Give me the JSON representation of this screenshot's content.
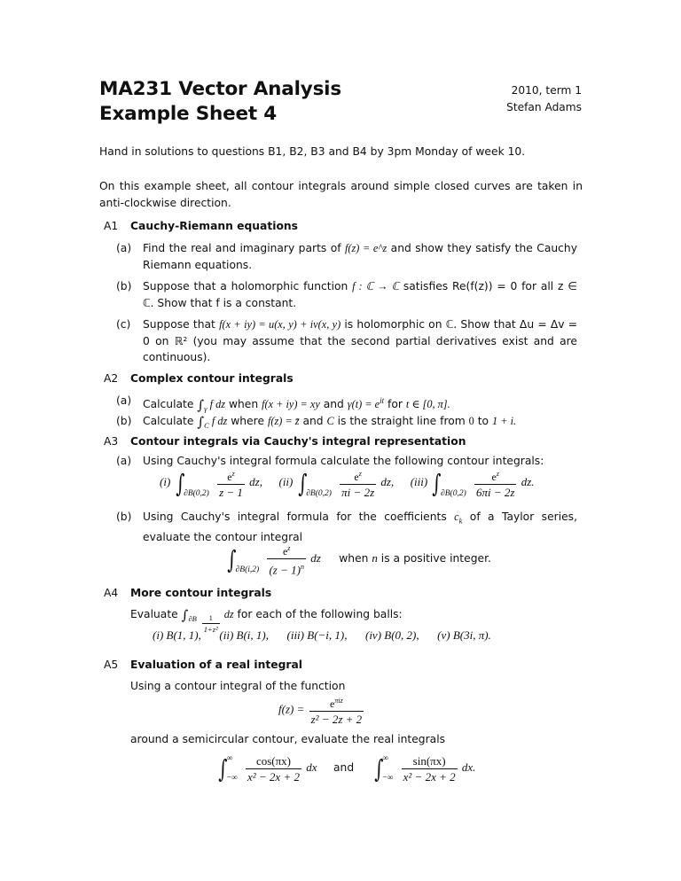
{
  "header": {
    "title_line1": "MA231 Vector Analysis",
    "title_line2": "Example Sheet 4",
    "term": "2010, term 1",
    "author": "Stefan Adams"
  },
  "intro": {
    "hand_in": "Hand in solutions to questions B1, B2, B3 and B4 by 3pm Monday of week 10.",
    "convention": "On this example sheet, all contour integrals around simple closed curves are taken in anti-clockwise direction."
  },
  "questions": {
    "a1": {
      "num": "A1",
      "title": "Cauchy-Riemann equations",
      "items": [
        {
          "label": "(a)",
          "text_before": "Find the real and imaginary parts of ",
          "math": "f(z) = e^z",
          "text_after": " and show they satisfy the Cauchy Riemann equations."
        },
        {
          "label": "(b)",
          "text_before": "Suppose that a holomorphic function ",
          "math": "f : ℂ → ℂ",
          "text_after": " satisfies Re(f(z)) = 0 for all z ∈ ℂ. Show that f is a constant."
        },
        {
          "label": "(c)",
          "text_before": "Suppose that ",
          "math": "f(x + iy) = u(x, y) + iv(x, y)",
          "text_after": " is holomorphic on ℂ. Show that Δu = Δv = 0 on ℝ² (you may assume that the second partial derivatives exist and are continuous)."
        }
      ]
    },
    "a2": {
      "num": "A2",
      "title": "Complex contour integrals",
      "items": [
        {
          "label": "(a)",
          "calc": "Calculate ",
          "integral": "∫",
          "sub": "γ",
          "fdz": " f dz",
          "when": " when ",
          "expr": "f(x + iy) = xy",
          "and": " and ",
          "expr2": "γ(t) = e",
          "exp": "it",
          "for": " for ",
          "range": "t ∈ [0, π]."
        },
        {
          "label": "(b)",
          "calc": "Calculate ",
          "integral": "∫",
          "sub": "C",
          "fdz": " f dz",
          "where": " where ",
          "expr": "f(z) = z̄",
          "and": " and ",
          "c": "C",
          "rest": " is the straight line from ",
          "from": "0",
          "to": " to ",
          "end": "1 + i."
        }
      ]
    },
    "a3": {
      "num": "A3",
      "title": "Contour integrals via Cauchy's integral representation",
      "part_a_label": "(a)",
      "part_a_text": "Using Cauchy's integral formula calculate the following contour integrals:",
      "integrals": [
        {
          "roman": "(i)",
          "sub": "∂B(0,2)",
          "num": "e",
          "num_exp": "z",
          "den": "z − 1",
          "tail": " dz,"
        },
        {
          "roman": "(ii)",
          "sub": "∂B(0,2)",
          "num": "e",
          "num_exp": "z",
          "den": "πi − 2z",
          "tail": " dz,"
        },
        {
          "roman": "(iii)",
          "sub": "∂B(0,2)",
          "num": "e",
          "num_exp": "z",
          "den": "6πi − 2z",
          "tail": " dz."
        }
      ],
      "part_b_label": "(b)",
      "part_b_text_1": "Using Cauchy's integral formula for the coefficients ",
      "part_b_ck": "c",
      "part_b_ck_sub": "k",
      "part_b_text_2": " of a Taylor series, evaluate the contour integral",
      "part_b_integral": {
        "sub": "∂B(i,2)",
        "num": "e",
        "num_exp": "z",
        "den": "(z − 1)",
        "den_exp": "n",
        "tail": " dz"
      },
      "part_b_when": "when ",
      "part_b_n": "n",
      "part_b_rest": " is a positive integer."
    },
    "a4": {
      "num": "A4",
      "title": "More contour integrals",
      "evaluate": "Evaluate ",
      "integral_sub": "∂B",
      "frac_num": "1",
      "frac_den": "1+z²",
      "dz": " dz",
      "tail": " for each of the following balls:",
      "balls": [
        {
          "roman": "(i)",
          "ball": "B(1, 1),"
        },
        {
          "roman": "(ii)",
          "ball": "B(i, 1),"
        },
        {
          "roman": "(iii)",
          "ball": "B(−i, 1),"
        },
        {
          "roman": "(iv)",
          "ball": "B(0, 2),"
        },
        {
          "roman": "(v)",
          "ball": "B(3i, π)."
        }
      ]
    },
    "a5": {
      "num": "A5",
      "title": "Evaluation of a real integral",
      "intro": "Using a contour integral of the function",
      "f_lhs": "f(z) =",
      "f_num": "e",
      "f_num_exp": "πiz",
      "f_den": "z² − 2z + 2",
      "middle": "around a semicircular contour, evaluate the real integrals",
      "int1": {
        "upper": "∞",
        "lower": "−∞",
        "num": "cos(πx)",
        "den": "x² − 2x + 2",
        "tail": " dx"
      },
      "and": "and",
      "int2": {
        "upper": "∞",
        "lower": "−∞",
        "num": "sin(πx)",
        "den": "x² − 2x + 2",
        "tail": " dx."
      }
    }
  }
}
